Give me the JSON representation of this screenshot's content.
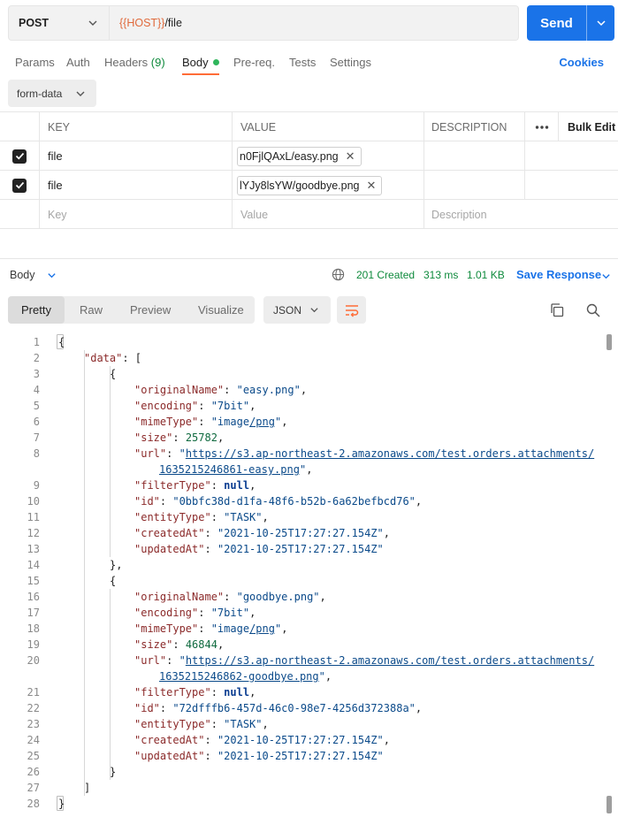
{
  "request": {
    "method": "POST",
    "url_var": "{{HOST}}",
    "url_path": "/file",
    "send_label": "Send"
  },
  "tabs": [
    {
      "label": "Params"
    },
    {
      "label": "Auth"
    },
    {
      "label": "Headers",
      "count": "(9)"
    },
    {
      "label": "Body"
    },
    {
      "label": "Pre-req."
    },
    {
      "label": "Tests"
    },
    {
      "label": "Settings"
    }
  ],
  "cookies_label": "Cookies",
  "body_type": "form-data",
  "params_table": {
    "headers": {
      "key": "KEY",
      "value": "VALUE",
      "description": "DESCRIPTION",
      "bulk_edit": "Bulk Edit"
    },
    "rows": [
      {
        "key": "file",
        "value": "n0FjlQAxL/easy.png"
      },
      {
        "key": "file",
        "value": "lYJy8lsYW/goodbye.png"
      }
    ],
    "placeholders": {
      "key": "Key",
      "value": "Value",
      "description": "Description"
    }
  },
  "response": {
    "section_label": "Body",
    "status": "201 Created",
    "time": "313 ms",
    "size": "1.01 KB",
    "save_label": "Save Response",
    "view_tabs": [
      "Pretty",
      "Raw",
      "Preview",
      "Visualize"
    ],
    "format": "JSON"
  },
  "code_lines": [
    "1",
    "2",
    "3",
    "4",
    "5",
    "6",
    "7",
    "8",
    "",
    "9",
    "10",
    "11",
    "12",
    "13",
    "14",
    "15",
    "16",
    "17",
    "18",
    "19",
    "20",
    "",
    "21",
    "22",
    "23",
    "24",
    "25",
    "26",
    "27",
    "28"
  ],
  "code": {
    "l1": "{",
    "l2k": "\"data\"",
    "l2r": ": [",
    "l3": "{",
    "l4k": "\"originalName\"",
    "l4v": "\"easy.png\"",
    "l5k": "\"encoding\"",
    "l5v": "\"7bit\"",
    "l6k": "\"mimeType\"",
    "l6v1": "\"image",
    "l6v2": "/png",
    "l6v3": "\"",
    "l7k": "\"size\"",
    "l7v": "25782",
    "l8k": "\"url\"",
    "l8v1": "https://s3.ap-northeast-2.amazonaws.com/test.orders.attachments/",
    "l8v2": "1635215246861-easy.png",
    "l9k": "\"filterType\"",
    "l9v": "null",
    "l10k": "\"id\"",
    "l10v": "\"0bbfc38d-d1fa-48f6-b52b-6a62befbcd76\"",
    "l11k": "\"entityType\"",
    "l11v": "\"TASK\"",
    "l12k": "\"createdAt\"",
    "l12v": "\"2021-10-25T17:27:27.154Z\"",
    "l13k": "\"updatedAt\"",
    "l13v": "\"2021-10-25T17:27:27.154Z\"",
    "l14": "},",
    "l15": "{",
    "l16k": "\"originalName\"",
    "l16v": "\"goodbye.png\"",
    "l17k": "\"encoding\"",
    "l17v": "\"7bit\"",
    "l18k": "\"mimeType\"",
    "l18v1": "\"image",
    "l18v2": "/png",
    "l18v3": "\"",
    "l19k": "\"size\"",
    "l19v": "46844",
    "l20k": "\"url\"",
    "l20v1": "https://s3.ap-northeast-2.amazonaws.com/test.orders.attachments/",
    "l20v2": "1635215246862-goodbye.png",
    "l21k": "\"filterType\"",
    "l21v": "null",
    "l22k": "\"id\"",
    "l22v": "\"72dfffb6-457d-46c0-98e7-4256d372388a\"",
    "l23k": "\"entityType\"",
    "l23v": "\"TASK\"",
    "l24k": "\"createdAt\"",
    "l24v": "\"2021-10-25T17:27:27.154Z\"",
    "l25k": "\"updatedAt\"",
    "l25v": "\"2021-10-25T17:27:27.154Z\"",
    "l26": "}",
    "l27": "]",
    "l28": "}"
  },
  "colors": {
    "accent": "#1a73e8",
    "active_tab_underline": "#ff6c37",
    "status_ok": "#0e8a3c",
    "url_variable": "#e06a3c"
  }
}
